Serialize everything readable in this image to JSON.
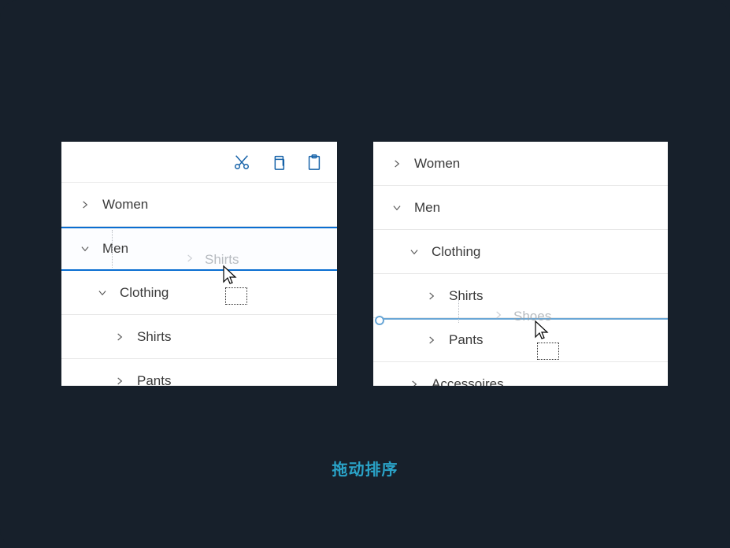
{
  "caption": "拖动排序",
  "left_panel": {
    "toolbar": {
      "cut": "cut",
      "copy": "copy",
      "paste": "paste"
    },
    "rows": {
      "women": "Women",
      "men": "Men",
      "clothing": "Clothing",
      "shirts": "Shirts",
      "pants": "Pants"
    },
    "drag_ghost": "Shirts"
  },
  "right_panel": {
    "rows": {
      "women": "Women",
      "men": "Men",
      "clothing": "Clothing",
      "shirts": "Shirts",
      "pants": "Pants",
      "accessoires": "Accessoires"
    },
    "drag_ghost": "Shoes"
  }
}
